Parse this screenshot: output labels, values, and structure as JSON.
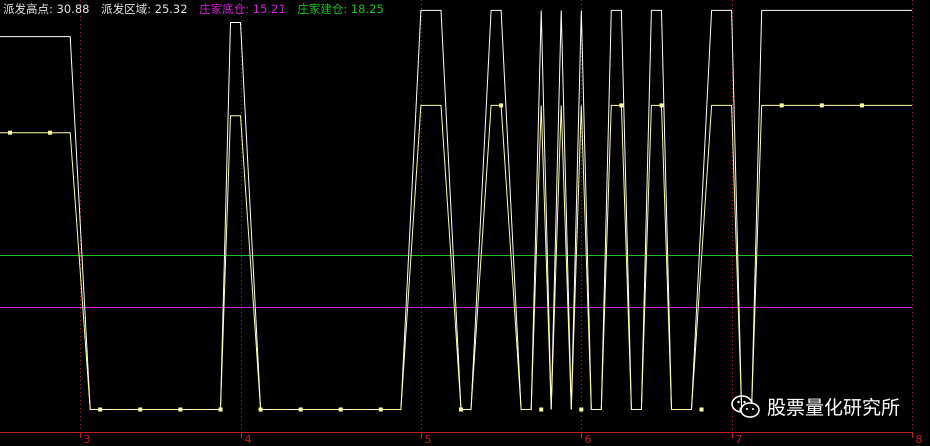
{
  "legend": {
    "high_label": "派发高点: 30.88",
    "zone_label": "派发区域: 25.32",
    "bottom_label": "庄家底仓: 15.21",
    "build_label": "庄家建仓: 18.25"
  },
  "watermark": {
    "text": "股票量化研究所",
    "icon": "wechat-icon"
  },
  "colors": {
    "background": "#000000",
    "high": "#ffffff",
    "zone": "#ffffa8",
    "bottom": "#d020d0",
    "build": "#20c020",
    "axis": "#c02020",
    "legend_text": "#e0e0e0"
  },
  "chart_data": {
    "type": "line",
    "ylim": [
      8,
      33
    ],
    "x_ticks": [
      {
        "label": "3",
        "x": 0
      },
      {
        "label": "4",
        "x": 16
      },
      {
        "label": "5",
        "x": 34
      },
      {
        "label": "6",
        "x": 50
      },
      {
        "label": "7",
        "x": 65
      },
      {
        "label": "8",
        "x": 83
      }
    ],
    "hlines": [
      {
        "name": "庄家建仓",
        "value": 18.25,
        "color": "#20c020"
      },
      {
        "name": "庄家底仓",
        "value": 15.21,
        "color": "#d020d0"
      }
    ],
    "series": [
      {
        "name": "派发高点",
        "color": "#ffffff",
        "points": [
          [
            -8,
            30.88
          ],
          [
            -1,
            30.88
          ],
          [
            1,
            9.3
          ],
          [
            14,
            9.3
          ],
          [
            15,
            31.7
          ],
          [
            16,
            31.7
          ],
          [
            18,
            9.3
          ],
          [
            32,
            9.3
          ],
          [
            34,
            32.4
          ],
          [
            36,
            32.4
          ],
          [
            38,
            9.3
          ],
          [
            39,
            9.3
          ],
          [
            41,
            32.4
          ],
          [
            42,
            32.4
          ],
          [
            44,
            9.3
          ],
          [
            45,
            9.3
          ],
          [
            46,
            32.4
          ],
          [
            47,
            9.3
          ],
          [
            48,
            32.4
          ],
          [
            49,
            9.3
          ],
          [
            50,
            32.4
          ],
          [
            51,
            9.3
          ],
          [
            52,
            9.3
          ],
          [
            53,
            32.4
          ],
          [
            54,
            32.4
          ],
          [
            55,
            9.3
          ],
          [
            56,
            9.3
          ],
          [
            57,
            32.4
          ],
          [
            58,
            32.4
          ],
          [
            59,
            9.3
          ],
          [
            61,
            9.3
          ],
          [
            63,
            32.4
          ],
          [
            65,
            32.4
          ],
          [
            66,
            9.3
          ],
          [
            67,
            9.3
          ],
          [
            68,
            32.4
          ],
          [
            83,
            32.4
          ]
        ]
      },
      {
        "name": "派发区域",
        "color": "#ffffa8",
        "points": [
          [
            -8,
            25.32
          ],
          [
            -1,
            25.32
          ],
          [
            1,
            9.3
          ],
          [
            14,
            9.3
          ],
          [
            15,
            26.3
          ],
          [
            16,
            26.3
          ],
          [
            18,
            9.3
          ],
          [
            32,
            9.3
          ],
          [
            34,
            26.9
          ],
          [
            36,
            26.9
          ],
          [
            38,
            9.3
          ],
          [
            39,
            9.3
          ],
          [
            41,
            26.9
          ],
          [
            42,
            26.9
          ],
          [
            44,
            9.3
          ],
          [
            45,
            9.3
          ],
          [
            46,
            26.9
          ],
          [
            47,
            9.3
          ],
          [
            48,
            26.9
          ],
          [
            49,
            9.3
          ],
          [
            50,
            26.9
          ],
          [
            51,
            9.3
          ],
          [
            52,
            9.3
          ],
          [
            53,
            26.9
          ],
          [
            54,
            26.9
          ],
          [
            55,
            9.3
          ],
          [
            56,
            9.3
          ],
          [
            57,
            26.9
          ],
          [
            58,
            26.9
          ],
          [
            59,
            9.3
          ],
          [
            61,
            9.3
          ],
          [
            63,
            26.9
          ],
          [
            65,
            26.9
          ],
          [
            66,
            9.3
          ],
          [
            67,
            9.3
          ],
          [
            68,
            26.9
          ],
          [
            83,
            26.9
          ]
        ],
        "markers": [
          [
            -7,
            25.32
          ],
          [
            -3,
            25.32
          ],
          [
            2,
            9.3
          ],
          [
            6,
            9.3
          ],
          [
            10,
            9.3
          ],
          [
            14,
            9.3
          ],
          [
            18,
            9.3
          ],
          [
            22,
            9.3
          ],
          [
            26,
            9.3
          ],
          [
            30,
            9.3
          ],
          [
            38,
            9.3
          ],
          [
            42,
            26.9
          ],
          [
            46,
            9.3
          ],
          [
            50,
            9.3
          ],
          [
            54,
            26.9
          ],
          [
            58,
            26.9
          ],
          [
            62,
            9.3
          ],
          [
            66,
            9.3
          ],
          [
            70,
            26.9
          ],
          [
            74,
            26.9
          ],
          [
            78,
            26.9
          ]
        ]
      }
    ]
  }
}
